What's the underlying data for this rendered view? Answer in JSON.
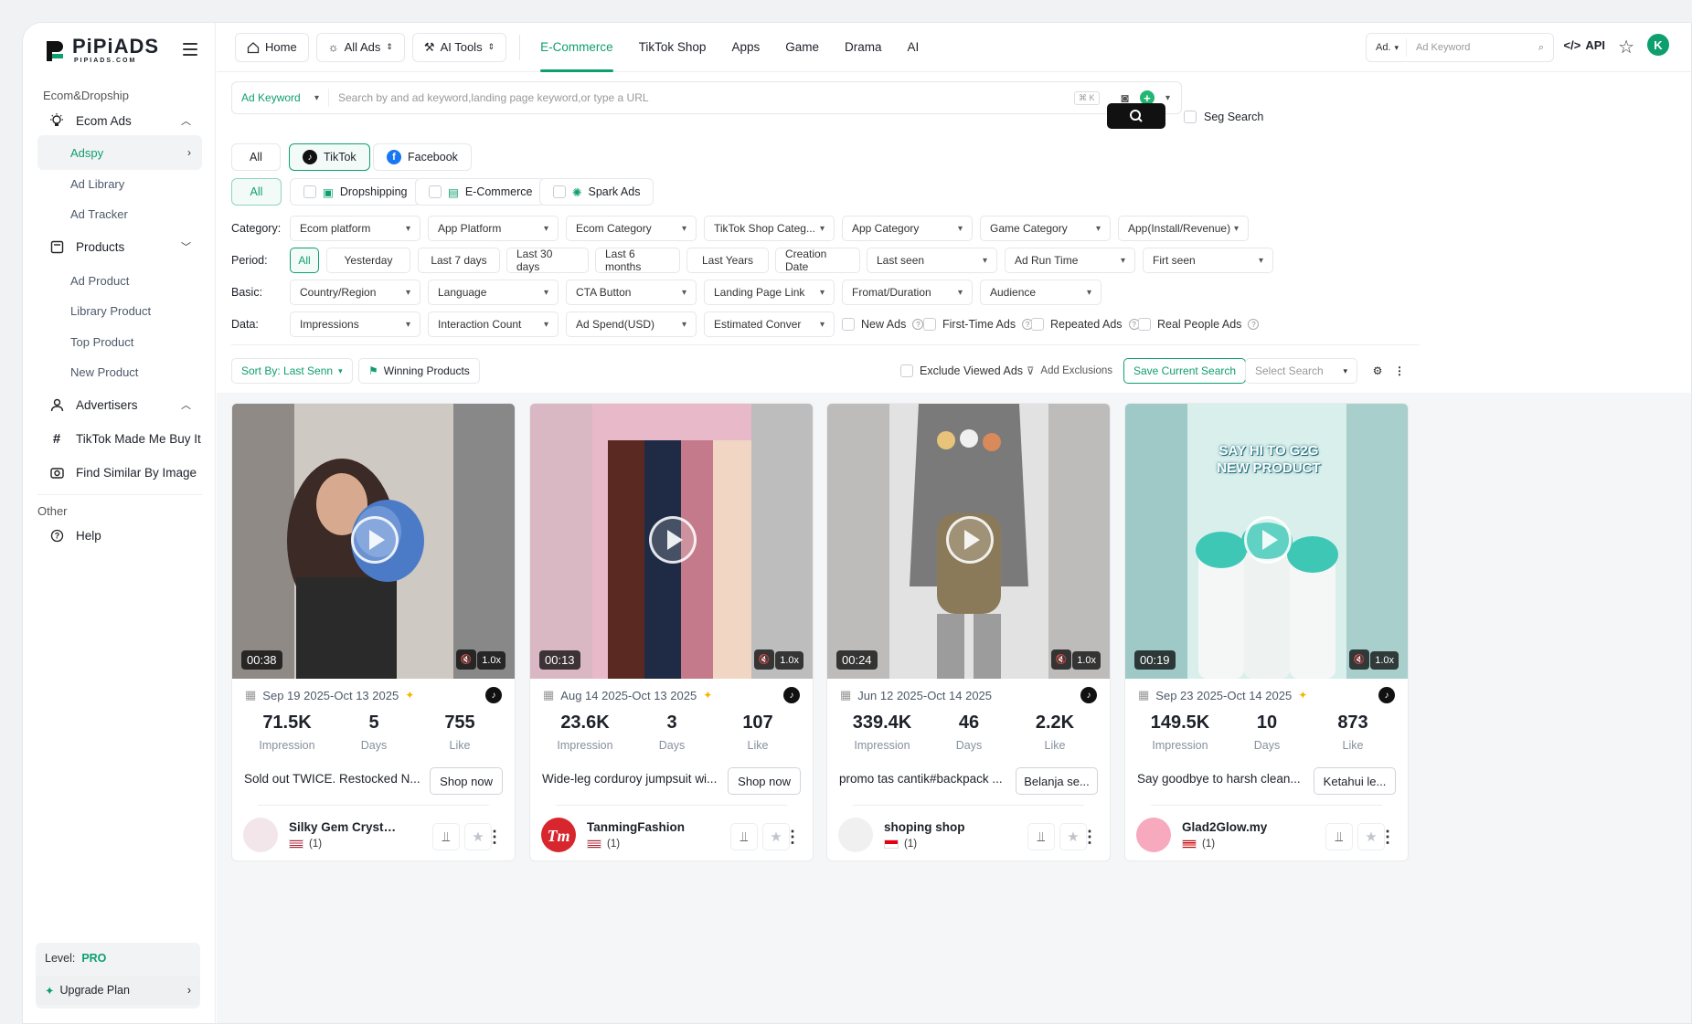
{
  "brand": {
    "name": "PiPiADS",
    "sub": "PIPIADS.COM",
    "accent": "#0e9f6e"
  },
  "sidebar": {
    "section1": "Ecom&Dropship",
    "ecom_ads": "Ecom Ads",
    "adspy": "Adspy",
    "ad_library": "Ad Library",
    "ad_tracker": "Ad Tracker",
    "products": "Products",
    "ad_product": "Ad Product",
    "library_product": "Library Product",
    "top_product": "Top Product",
    "new_product": "New Product",
    "advertisers": "Advertisers",
    "tiktok_made": "TikTok Made Me Buy It",
    "find_similar": "Find Similar By Image",
    "other": "Other",
    "help": "Help",
    "level_label": "Level:",
    "level_value": "PRO",
    "upgrade": "Upgrade Plan"
  },
  "topbar": {
    "home": "Home",
    "all_ads": "All Ads",
    "ai_tools": "AI Tools",
    "tabs": [
      "E-Commerce",
      "TikTok Shop",
      "Apps",
      "Game",
      "Drama",
      "AI"
    ],
    "search_select": "Ad.",
    "search_placeholder": "Ad Keyword",
    "api": "API",
    "avatar": "K"
  },
  "search": {
    "type": "Ad Keyword",
    "placeholder": "Search by and ad keyword,landing page keyword,or type a URL",
    "kbd": "⌘ K",
    "seg": "Seg Search"
  },
  "platforms": {
    "all": "All",
    "tiktok": "TikTok",
    "facebook": "Facebook"
  },
  "types": {
    "all": "All",
    "dropshipping": "Dropshipping",
    "ecommerce": "E-Commerce",
    "spark": "Spark Ads"
  },
  "filters": {
    "category_label": "Category:",
    "category": [
      "Ecom platform",
      "App Platform",
      "Ecom Category",
      "TikTok Shop Categ...",
      "App Category",
      "Game Category",
      "App(Install/Revenue)"
    ],
    "period_label": "Period:",
    "period": [
      "All",
      "Yesterday",
      "Last 7 days",
      "Last 30 days",
      "Last 6 months",
      "Last Years",
      "Creation Date",
      "Last seen",
      "Ad Run Time",
      "Firt seen"
    ],
    "basic_label": "Basic:",
    "basic": [
      "Country/Region",
      "Language",
      "CTA Button",
      "Landing Page Link",
      "Fromat/Duration",
      "Audience"
    ],
    "data_label": "Data:",
    "data": [
      "Impressions",
      "Interaction Count",
      "Ad Spend(USD)",
      "Estimated Conver"
    ],
    "checks": [
      "New Ads",
      "First-Time Ads",
      "Repeated Ads",
      "Real People Ads"
    ]
  },
  "toolbar": {
    "sort": "Sort By: Last Senn",
    "winning": "Winning Products",
    "exclude": "Exclude Viewed Ads",
    "add_excl": "Add Exclusions",
    "save": "Save Current Search",
    "select_search": "Select Search"
  },
  "cards": [
    {
      "duration": "00:38",
      "speed": "1.0x",
      "dates": "Sep 19 2025-Oct 13 2025",
      "impression": "71.5K",
      "days": "5",
      "likes": "755",
      "impression_label": "Impression",
      "days_label": "Days",
      "like_label": "Like",
      "desc": "Sold out TWICE. Restocked N...",
      "cta": "Shop now",
      "advertiser": "Silky Gem Crystal ...",
      "count": "(1)",
      "country": "US"
    },
    {
      "duration": "00:13",
      "speed": "1.0x",
      "dates": "Aug 14 2025-Oct 13 2025",
      "impression": "23.6K",
      "days": "3",
      "likes": "107",
      "impression_label": "Impression",
      "days_label": "Days",
      "like_label": "Like",
      "desc": "Wide-leg corduroy jumpsuit wi...",
      "cta": "Shop now",
      "advertiser": "TanmingFashion",
      "count": "(1)",
      "country": "US"
    },
    {
      "duration": "00:24",
      "speed": "1.0x",
      "dates": "Jun 12 2025-Oct 14 2025",
      "impression": "339.4K",
      "days": "46",
      "likes": "2.2K",
      "impression_label": "Impression",
      "days_label": "Days",
      "like_label": "Like",
      "desc": "promo tas cantik#backpack ...",
      "cta": "Belanja se...",
      "advertiser": "shoping shop",
      "count": "(1)",
      "country": "ID"
    },
    {
      "duration": "00:19",
      "speed": "1.0x",
      "dates": "Sep 23 2025-Oct 14 2025",
      "impression": "149.5K",
      "days": "10",
      "likes": "873",
      "impression_label": "Impression",
      "days_label": "Days",
      "like_label": "Like",
      "desc": "Say goodbye to harsh clean...",
      "cta": "Ketahui le...",
      "advertiser": "Glad2Glow.my",
      "count": "(1)",
      "country": "MY",
      "overlay": "SAY HI TO G2G NEW PRODUCT"
    }
  ]
}
